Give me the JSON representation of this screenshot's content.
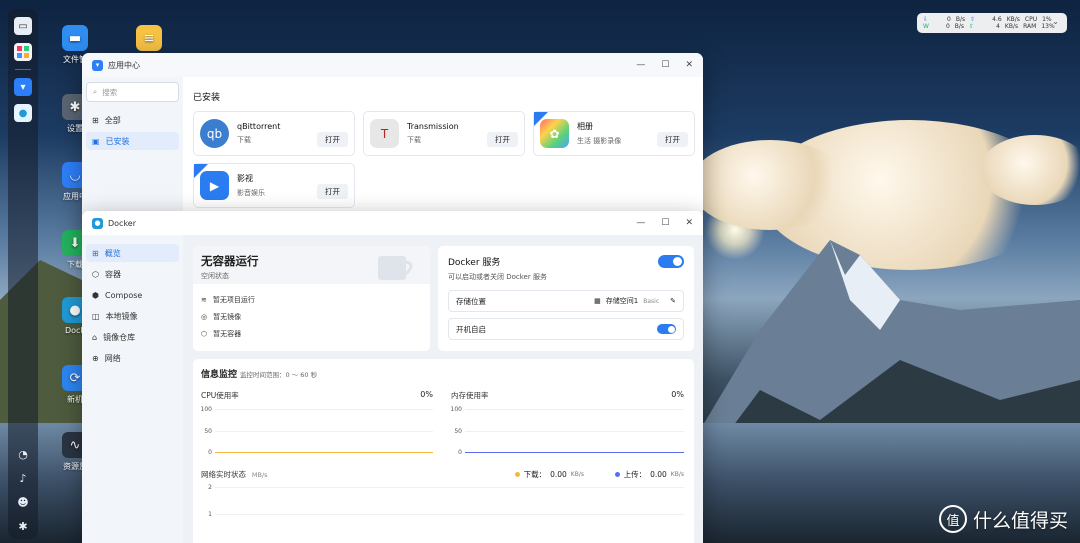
{
  "desktop": {
    "icons": [
      {
        "label": "文件管",
        "icon": "folder-icon",
        "color": "#2f8cf0"
      },
      {
        "label": "设置",
        "icon": "gear-icon",
        "color": "#5b6573"
      },
      {
        "label": "应用中",
        "icon": "app-center-icon",
        "color": "#2d7ff9"
      },
      {
        "label": "下载",
        "icon": "download-icon",
        "color": "#22b35e"
      },
      {
        "label": "Dock",
        "icon": "docker-icon",
        "color": "#1f9ad6"
      },
      {
        "label": "新机",
        "icon": "sync-icon",
        "color": "#2c86f2"
      },
      {
        "label": "资源监",
        "icon": "monitor-icon",
        "color": "#2a3442"
      }
    ],
    "widget": {
      "row1": [
        "⇩",
        "0",
        "B/s",
        "⇧",
        "4.6",
        "KB/s",
        "CPU",
        "1%"
      ],
      "row2": [
        "W",
        "0",
        "B/s",
        "⇧",
        "4",
        "KB/s",
        "RAM",
        "13%"
      ]
    },
    "watermark": "什么值得买",
    "watermark_mark": "值"
  },
  "app_center": {
    "title": "应用中心",
    "search_placeholder": "搜索",
    "nav": [
      "全部",
      "已安装"
    ],
    "section": "已安装",
    "apps": [
      {
        "name": "qBittorrent",
        "category": "下载",
        "open": "打开",
        "logo": "qb",
        "color": "#3b7ecf",
        "badge": false
      },
      {
        "name": "Transmission",
        "category": "下载",
        "open": "打开",
        "logo": "T",
        "color": "#b0281f",
        "badge": false
      },
      {
        "name": "相册",
        "category": "生活 摄影录像",
        "open": "打开",
        "logo": "✿",
        "color": "#f2a43a",
        "badge": true
      },
      {
        "name": "影视",
        "category": "影音娱乐",
        "open": "打开",
        "logo": "▶",
        "color": "#2a7cf0",
        "badge": true
      }
    ]
  },
  "docker": {
    "title": "Docker",
    "nav": [
      "概览",
      "容器",
      "Compose",
      "本地镜像",
      "镜像仓库",
      "网络"
    ],
    "status": {
      "title": "无容器运行",
      "subtitle": "空闲状态",
      "items": [
        "暂无项目运行",
        "暂无镜像",
        "暂无容器"
      ]
    },
    "service": {
      "title": "Docker 服务",
      "subtitle": "可以启动或者关闭 Docker 服务",
      "enabled": true,
      "storage_label": "存储位置",
      "storage_value": "存储空间1",
      "storage_tag": "Basic",
      "autostart_label": "开机自启",
      "autostart": true
    },
    "monitor": {
      "title": "信息监控",
      "range": "监控时间范围：0 ～ 60 秒",
      "cpu_label": "CPU使用率",
      "cpu_value": "0%",
      "mem_label": "内存使用率",
      "mem_value": "0%",
      "net_label": "网络实时状态",
      "net_unit": "MB/s",
      "down_label": "下载：",
      "down_value": "0.00",
      "down_unit": "KB/s",
      "up_label": "上传：",
      "up_value": "0.00",
      "up_unit": "KB/s",
      "cpu_color": "#f5b942",
      "mem_color": "#5b6ef0"
    }
  },
  "chart_data": [
    {
      "type": "line",
      "title": "CPU使用率",
      "x": [
        0,
        60
      ],
      "series": [
        {
          "values": [
            0,
            0
          ]
        }
      ],
      "ylim": [
        0,
        100
      ],
      "yticks": [
        "100",
        "50",
        "0"
      ]
    },
    {
      "type": "line",
      "title": "内存使用率",
      "x": [
        0,
        60
      ],
      "series": [
        {
          "values": [
            0,
            0
          ]
        }
      ],
      "ylim": [
        0,
        100
      ],
      "yticks": [
        "100",
        "50",
        "0"
      ]
    },
    {
      "type": "line",
      "title": "网络实时状态",
      "series": [
        {
          "name": "下载",
          "values": [
            0,
            0
          ]
        },
        {
          "name": "上传",
          "values": [
            0,
            0
          ]
        }
      ],
      "yticks": [
        "2",
        "1"
      ]
    }
  ]
}
